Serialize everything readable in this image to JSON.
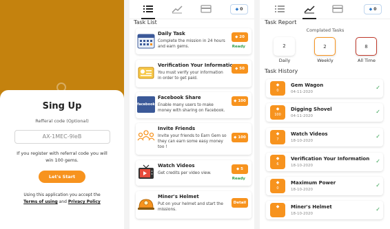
{
  "signup": {
    "title": "Sing Up",
    "referral_label": "Refferal code (Optional)",
    "referral_value": "AX-1MEC-9leB",
    "hint": "If you register with referral code you will win 100 gems.",
    "start_button": "Let's Start",
    "terms_prefix": "Using this application you accept the",
    "terms_link": "Terms of using",
    "terms_and": "and",
    "privacy_link": "Privacy Policy"
  },
  "colors": {
    "brand_brown": "#C4820E",
    "accent_orange": "#F7931E",
    "ready_green": "#2e9d4a",
    "gem_blue": "#2d78c9"
  },
  "tasklist": {
    "gem_count": "0",
    "section_title": "Task List",
    "tasks": [
      {
        "title": "Daily Task",
        "desc": "Complete the mission in 24 hours and earn gems.",
        "button": "20",
        "status": "Ready",
        "icon": "calendar-icon"
      },
      {
        "title": "Verification Your Information",
        "desc": "You must verify your information in order to get paid.",
        "button": "50",
        "status": "",
        "icon": "id-card-icon"
      },
      {
        "title": "Facebook Share",
        "desc": "Enable many users to make money with sharing on Facebook.",
        "button": "100",
        "status": "",
        "icon": "facebook-icon",
        "icon_text": "facebook"
      },
      {
        "title": "Invite Friends",
        "desc": "Invite your friends to Earn Gem so they can earn some easy money too !",
        "button": "100",
        "status": "",
        "icon": "group-icon"
      },
      {
        "title": "Watch Videos",
        "desc": "Get credits per video view.",
        "button": "5",
        "status": "Ready",
        "icon": "tv-icon"
      },
      {
        "title": "Miner's Helmet",
        "desc": "Put on your helmet and start the missions.",
        "button": "Detail",
        "status": "",
        "icon": "helmet-icon"
      }
    ]
  },
  "report": {
    "gem_count": "0",
    "section_title": "Task Report",
    "completed_label": "Complated Tasks",
    "stats": [
      {
        "label": "Daily",
        "value": "2"
      },
      {
        "label": "Weekly",
        "value": "2"
      },
      {
        "label": "All Time",
        "value": "8"
      }
    ],
    "history_title": "Task History",
    "history": [
      {
        "title": "Gem Wagon",
        "date": "04-11-2020",
        "gems": "0"
      },
      {
        "title": "Digging Shovel",
        "date": "04-11-2020",
        "gems": "100"
      },
      {
        "title": "Watch Videos",
        "date": "18-10-2020",
        "gems": "7"
      },
      {
        "title": "Verification Your Information",
        "date": "18-10-2020",
        "gems": "6"
      },
      {
        "title": "Maximum Power",
        "date": "18-10-2020",
        "gems": "0"
      },
      {
        "title": "Miner's Helmet",
        "date": "18-10-2020",
        "gems": ""
      }
    ]
  }
}
